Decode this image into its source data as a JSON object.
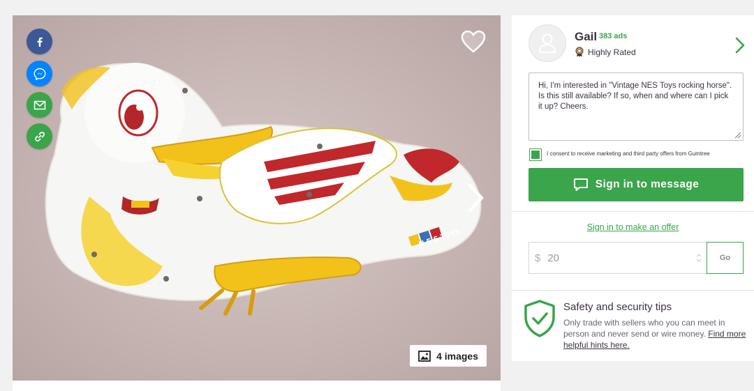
{
  "gallery": {
    "image_count_label": "4 images",
    "photo_text": "N E S TOYS"
  },
  "share": {
    "facebook_icon": "facebook-icon",
    "messenger_icon": "messenger-icon",
    "email_icon": "email-icon",
    "link_icon": "link-icon"
  },
  "seller": {
    "name": "Gail",
    "ads_count": "383 ads",
    "rating": "Highly Rated"
  },
  "contact": {
    "message": "Hi, I'm interested in \"Vintage NES Toys rocking horse\". Is this still available? If so, when and where can I pick it up? Cheers.",
    "consent_text": "I consent to receive marketing and third party offers from Gumtree",
    "consent_checked": true,
    "sign_in_message_label": "Sign in to message",
    "sign_in_offer_label": "Sign in to make an offer"
  },
  "offer": {
    "currency": "$",
    "value": "20",
    "go_label": "Go"
  },
  "safety": {
    "title": "Safety and security tips",
    "body": "Only trade with sellers who you can meet in person and never send or wire money.",
    "link_text": "Find more helpful hints here."
  },
  "colors": {
    "brand_green": "#3aa54a",
    "facebook_blue": "#3b5998",
    "messenger_blue": "#0084ff"
  }
}
